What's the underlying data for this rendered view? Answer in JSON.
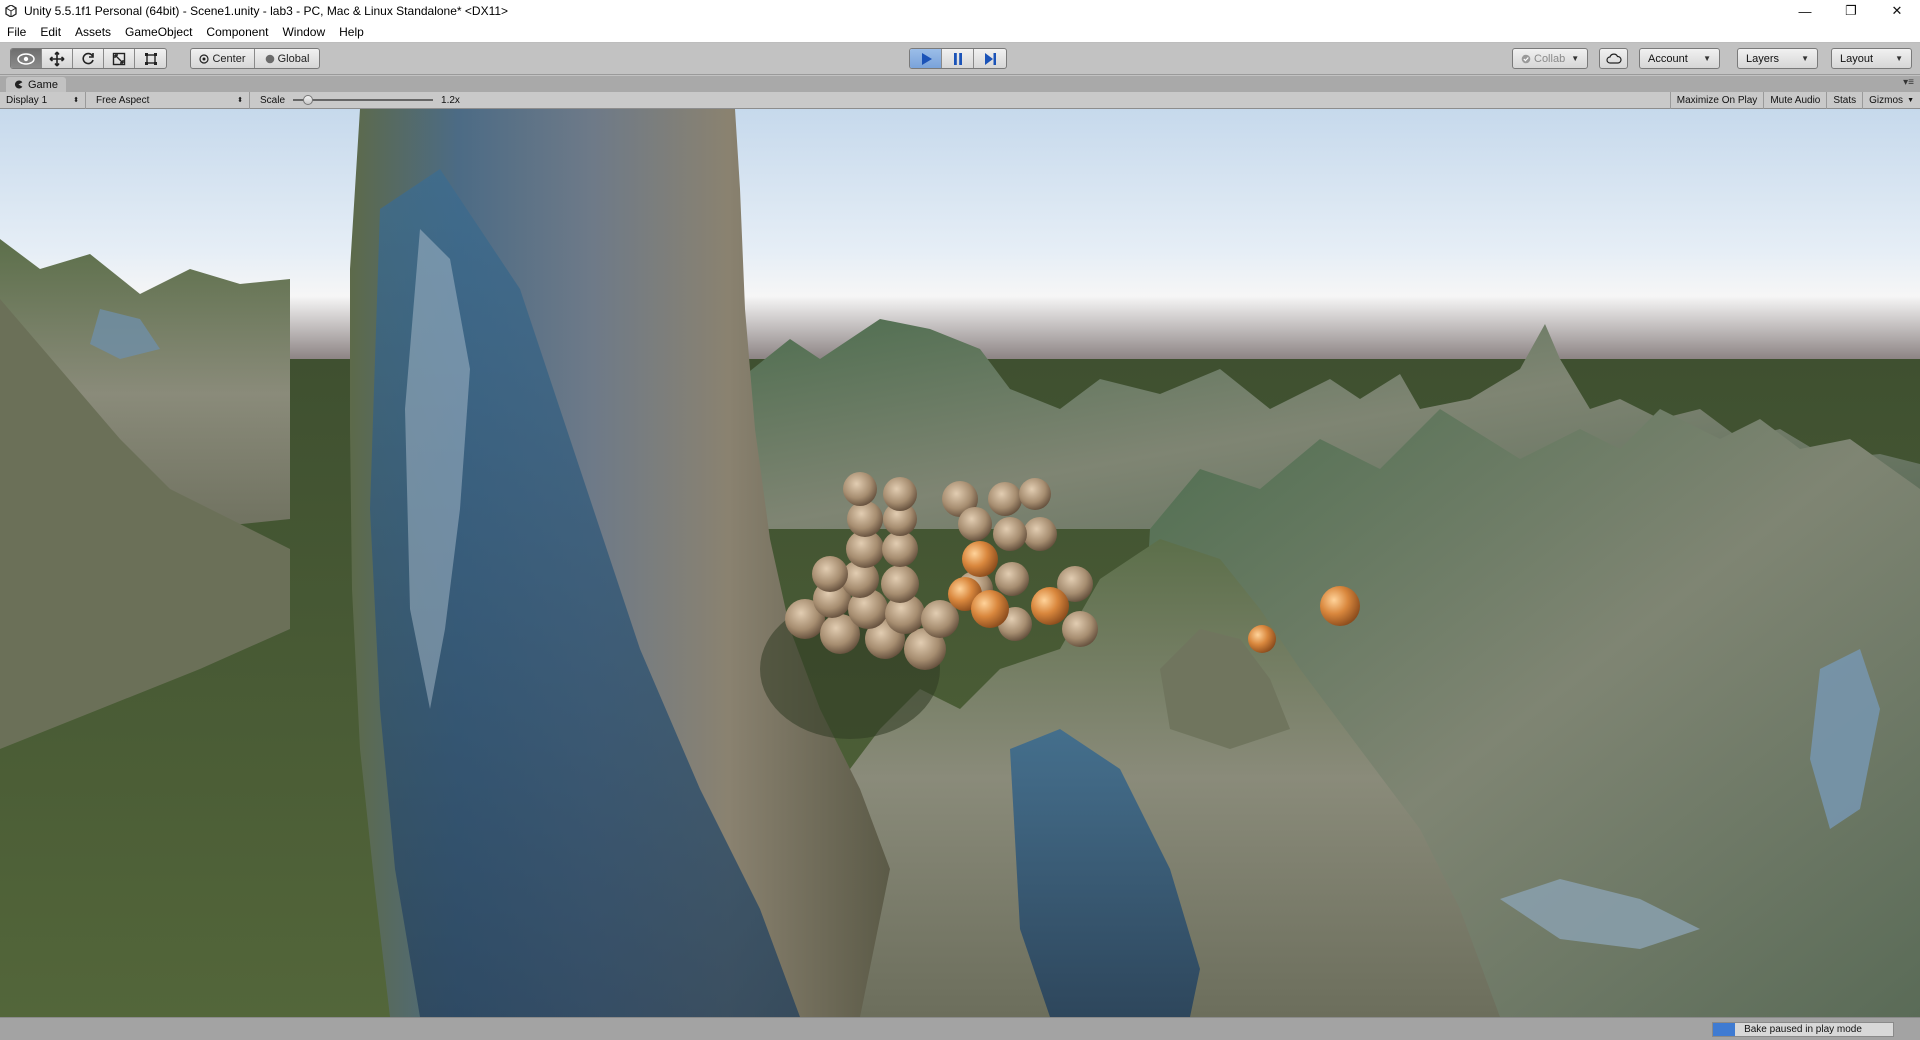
{
  "window": {
    "title": "Unity 5.5.1f1 Personal (64bit) - Scene1.unity - lab3 - PC, Mac & Linux Standalone* <DX11>",
    "minimize": "—",
    "maximize": "❐",
    "close": "✕"
  },
  "menu": [
    "File",
    "Edit",
    "Assets",
    "GameObject",
    "Component",
    "Window",
    "Help"
  ],
  "toolbar": {
    "pivot_label": "Center",
    "space_label": "Global",
    "collab_label": "Collab",
    "account_label": "Account",
    "layers_label": "Layers",
    "layout_label": "Layout",
    "play_state": "playing"
  },
  "game_tab": {
    "label": "Game",
    "display": "Display 1",
    "aspect": "Free Aspect",
    "scale_label": "Scale",
    "scale_value": "1.2x",
    "maximize_on_play": "Maximize On Play",
    "mute_audio": "Mute Audio",
    "stats": "Stats",
    "gizmos": "Gizmos"
  },
  "status": {
    "bake_text": "Bake paused in play mode",
    "bake_progress": 0.12
  },
  "colors": {
    "sky_top": "#c6d9ec",
    "horizon": "#7c7272",
    "grass": "#4b5d35",
    "play_active": "#7aa3da",
    "orange_sphere": "#d9873d"
  }
}
